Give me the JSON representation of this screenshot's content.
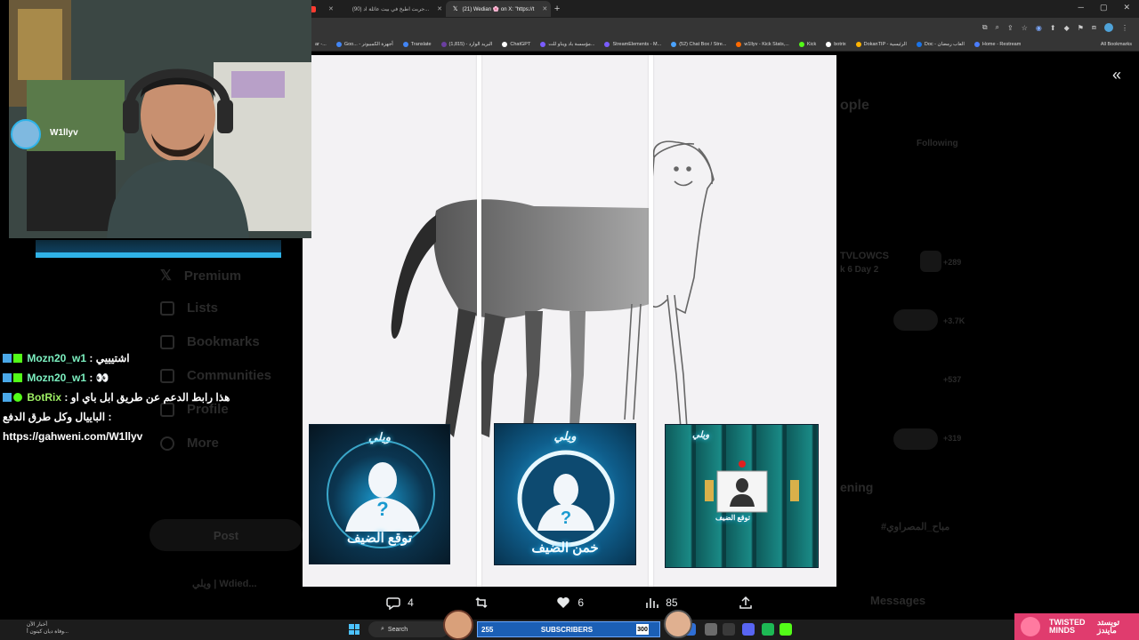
{
  "browser": {
    "tabs": [
      {
        "label": "",
        "icon_color": "#ff3b30"
      },
      {
        "label": "(90) جربت اطبخ في بيت عائلة اد...",
        "icon_color": "#ff0000"
      },
      {
        "label": "(21) Wedian 🌸 on X: \"https://t",
        "icon_color": "#ffffff",
        "active": true
      }
    ],
    "bookmarks": [
      {
        "label": "ar -...",
        "color": "#e0a030"
      },
      {
        "label": "Goo... - أجهزة الكمبيوتر",
        "color": "#4285f4"
      },
      {
        "label": "Translate",
        "color": "#4285f4"
      },
      {
        "label": "البريد الوارد - (1,815)",
        "color": "#6b3fa0"
      },
      {
        "label": "ChatGPT",
        "color": "#ffffff"
      },
      {
        "label": "مؤسسة باد ويناو للت...",
        "color": "#7a5cff"
      },
      {
        "label": "StreamElements - M...",
        "color": "#7a5cff"
      },
      {
        "label": "(52) Chat Box / Stre...",
        "color": "#4aa3ff"
      },
      {
        "label": "w1llyv - Kick Stats,...",
        "color": "#ff6a00"
      },
      {
        "label": "Kick",
        "color": "#53fc18"
      },
      {
        "label": "botrix",
        "color": "#ffffff"
      },
      {
        "label": "DokanTIP - الرئيسية",
        "color": "#ffb300"
      },
      {
        "label": "Doc - العاب رمضان",
        "color": "#1a73e8"
      },
      {
        "label": "Home - Restream",
        "color": "#4a7dff"
      }
    ],
    "all_bookmarks": "All Bookmarks"
  },
  "x_background": {
    "nav": [
      "Premium",
      "Lists",
      "Bookmarks",
      "Communities",
      "Profile",
      "More"
    ],
    "post_button": "Post",
    "right_texts": [
      "ople",
      "Following",
      "TVLOWCS",
      "k 6 Day 2",
      "+289",
      "+3.7K",
      "+537",
      "+319",
      "ening",
      "#مباح_المصراوي",
      "Messages"
    ],
    "bottom_user": "ويلي | Wdied..."
  },
  "stream_overlay": {
    "channel_name": "W1llyv",
    "chat": [
      {
        "user": "Mozn20_w1",
        "text": ": اشتيييي",
        "bot": false
      },
      {
        "user": "Mozn20_w1",
        "text": ": 👀",
        "bot": false
      },
      {
        "user": "BotRix",
        "text": ": هذا رابط الدعم عن طريق ابل باي او",
        "bot": true
      },
      {
        "user": "",
        "text": "الباييال وكل طرق الدفع :",
        "bot": false
      },
      {
        "user": "",
        "text": "https://gahweni.com/W1llyv",
        "bot": false
      }
    ],
    "thumbnails": [
      {
        "brand": "ويلي",
        "caption": "توقع الضيف"
      },
      {
        "brand": "ويلي",
        "caption": "خمن الضيف"
      },
      {
        "brand": "ويلي",
        "caption": "توقع الضيف"
      }
    ],
    "subscribers": {
      "count": "255",
      "label": "SUBSCRIBERS",
      "goal": "300"
    },
    "sponsor": {
      "en": "TWISTED MINDS",
      "ar": "تويستد مايندز"
    }
  },
  "post_actions": {
    "replies": "4",
    "reposts": "",
    "likes": "6",
    "views": "85"
  },
  "taskbar": {
    "weather_line1": "أخبار الآن",
    "weather_line2": "وفاة ديان كيتون أ...",
    "search": "Search"
  },
  "colors": {
    "accent": "#1d9bf0",
    "kick_green": "#53fc18",
    "sub_bar": "#1b5fb5",
    "sponsor": "#e03c6e"
  }
}
